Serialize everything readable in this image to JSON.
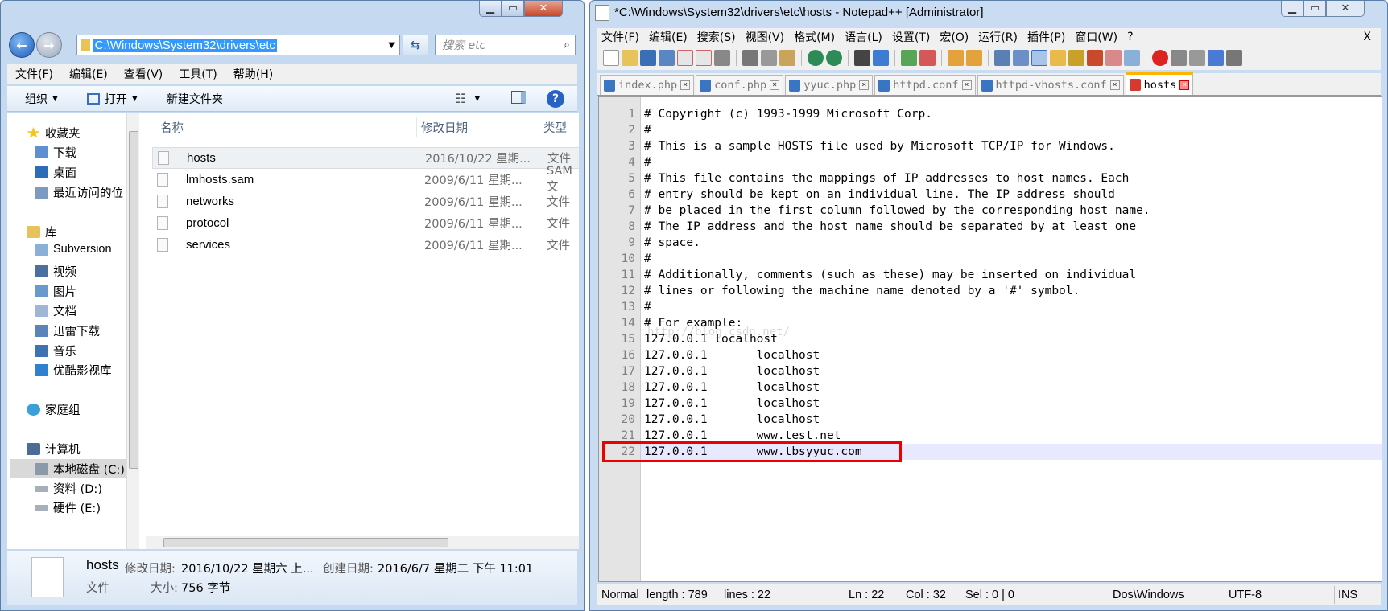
{
  "explorer": {
    "address": "C:\\Windows\\System32\\drivers\\etc",
    "search_placeholder": "搜索 etc",
    "menu": [
      "文件(F)",
      "编辑(E)",
      "查看(V)",
      "工具(T)",
      "帮助(H)"
    ],
    "toolbar": {
      "organize": "组织",
      "open": "打开",
      "new_folder": "新建文件夹"
    },
    "nav": {
      "favorites": "收藏夹",
      "downloads": "下载",
      "desktop": "桌面",
      "recent": "最近访问的位",
      "libraries": "库",
      "subversion": "Subversion",
      "videos": "视频",
      "pictures": "图片",
      "documents": "文档",
      "xunlei": "迅雷下载",
      "music": "音乐",
      "youku": "优酷影视库",
      "homegroup": "家庭组",
      "computer": "计算机",
      "drive_c": "本地磁盘 (C:)",
      "drive_d": "资料 (D:)",
      "drive_e": "硬件 (E:)"
    },
    "columns": {
      "name": "名称",
      "date": "修改日期",
      "type": "类型"
    },
    "files": [
      {
        "name": "hosts",
        "date": "2016/10/22 星期...",
        "type": "文件"
      },
      {
        "name": "lmhosts.sam",
        "date": "2009/6/11 星期...",
        "type": "SAM 文"
      },
      {
        "name": "networks",
        "date": "2009/6/11 星期...",
        "type": "文件"
      },
      {
        "name": "protocol",
        "date": "2009/6/11 星期...",
        "type": "文件"
      },
      {
        "name": "services",
        "date": "2009/6/11 星期...",
        "type": "文件"
      }
    ],
    "details": {
      "name": "hosts",
      "modified_label": "修改日期:",
      "modified": "2016/10/22 星期六 上...",
      "created_label": "创建日期:",
      "created": "2016/6/7 星期二 下午 11:01",
      "type": "文件",
      "size_label": "大小:",
      "size": "756 字节"
    }
  },
  "npp": {
    "title": "*C:\\Windows\\System32\\drivers\\etc\\hosts - Notepad++ [Administrator]",
    "menu": [
      "文件(F)",
      "编辑(E)",
      "搜索(S)",
      "视图(V)",
      "格式(M)",
      "语言(L)",
      "设置(T)",
      "宏(O)",
      "运行(R)",
      "插件(P)",
      "窗口(W)",
      "?"
    ],
    "menu_close": "X",
    "tabs": [
      "index.php",
      "conf.php",
      "yyuc.php",
      "httpd.conf",
      "httpd-vhosts.conf",
      "hosts"
    ],
    "lines": [
      "# Copyright (c) 1993-1999 Microsoft Corp.",
      "#",
      "# This is a sample HOSTS file used by Microsoft TCP/IP for Windows.",
      "#",
      "# This file contains the mappings of IP addresses to host names. Each",
      "# entry should be kept on an individual line. The IP address should",
      "# be placed in the first column followed by the corresponding host name.",
      "# The IP address and the host name should be separated by at least one",
      "# space.",
      "#",
      "# Additionally, comments (such as these) may be inserted on individual",
      "# lines or following the machine name denoted by a '#' symbol.",
      "#",
      "# For example:",
      "127.0.0.1 localhost",
      "127.0.0.1       localhost",
      "127.0.0.1       localhost",
      "127.0.0.1       localhost",
      "127.0.0.1       localhost",
      "127.0.0.1       localhost",
      "127.0.0.1       www.test.net",
      "127.0.0.1       www.tbsyyuc.com"
    ],
    "line_numbers": [
      "1",
      "2",
      "3",
      "4",
      "5",
      "6",
      "7",
      "8",
      "9",
      "10",
      "11",
      "12",
      "13",
      "14",
      "15",
      "16",
      "17",
      "18",
      "19",
      "20",
      "21",
      "22"
    ],
    "watermark": "http://blog.csdn.net/",
    "status": {
      "mode": "Normal",
      "length": "length : 789",
      "lines": "lines : 22",
      "ln": "Ln : 22",
      "col": "Col : 32",
      "sel": "Sel : 0 | 0",
      "eol": "Dos\\Windows",
      "encoding": "UTF-8",
      "ins": "INS"
    }
  },
  "colors": {
    "highlight": "#e00000",
    "selection": "#3399ff",
    "tab_active": "#ffb500"
  }
}
